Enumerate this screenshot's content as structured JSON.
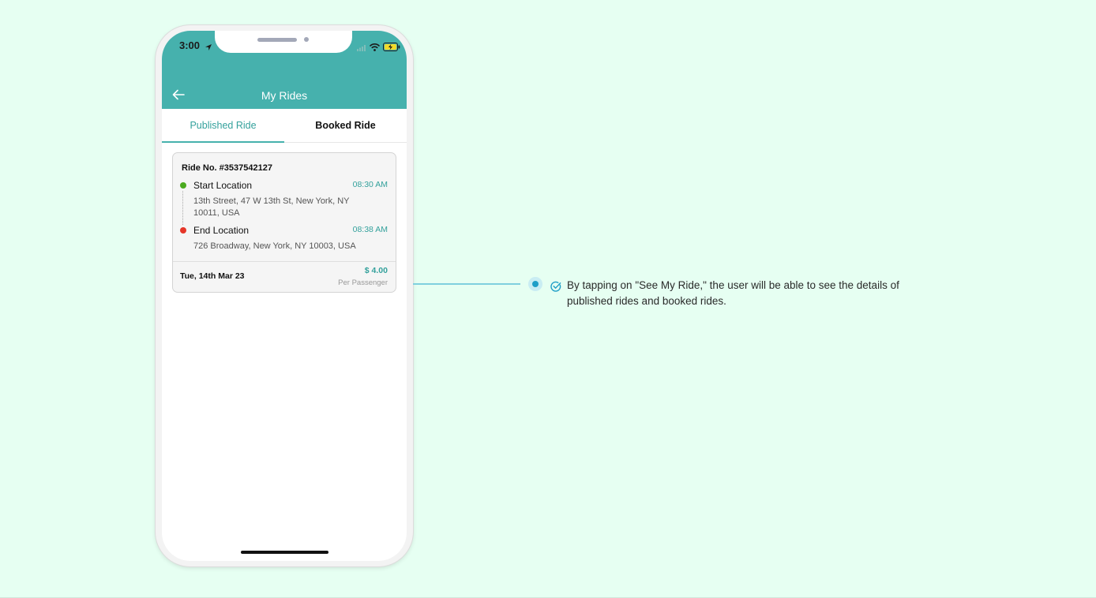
{
  "status_bar": {
    "time": "3:00"
  },
  "header": {
    "title": "My Rides"
  },
  "tabs": [
    {
      "label": "Published Ride",
      "active": true
    },
    {
      "label": "Booked Ride",
      "active": false
    }
  ],
  "ride": {
    "ride_no": "Ride No. #3537542127",
    "start": {
      "label": "Start Location",
      "time": "08:30 AM",
      "address": "13th Street, 47 W 13th St, New York, NY 10011, USA"
    },
    "end": {
      "label": "End Location",
      "time": "08:38 AM",
      "address": "726 Broadway, New York, NY 10003, USA"
    },
    "date": "Tue, 14th Mar 23",
    "price": "$ 4.00",
    "price_unit": "Per Passenger"
  },
  "callout": {
    "text": "By tapping on \"See My Ride,\" the user will be able to see the details of published rides and booked rides."
  },
  "colors": {
    "background": "#e6fff2",
    "accent": "#46b1ad",
    "start_dot": "#4aaa1f",
    "end_dot": "#e53629",
    "callout_dot": "#1e9ec7"
  },
  "icons": [
    "location-arrow-icon",
    "signal-icon",
    "wifi-icon",
    "battery-icon",
    "back-arrow-icon",
    "check-circle-icon"
  ]
}
